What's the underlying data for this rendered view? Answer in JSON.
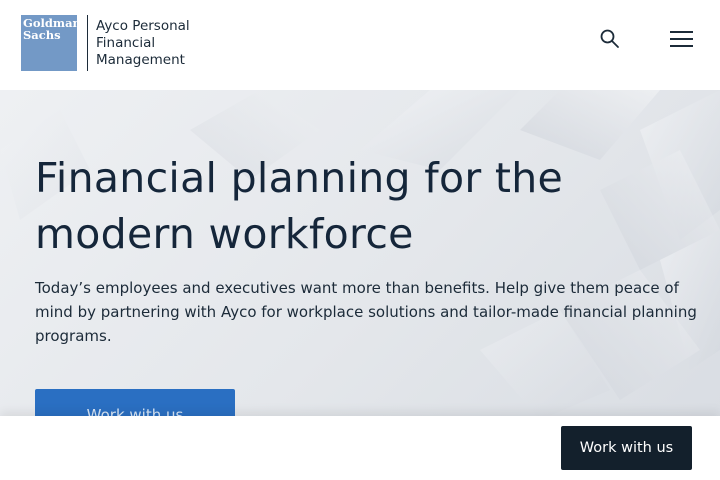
{
  "header": {
    "brand_logo": {
      "line1": "Goldman",
      "line2": "Sachs",
      "color": "#7399c6"
    },
    "product_name_lines": [
      "Ayco Personal",
      "Financial",
      "Management"
    ],
    "search_icon": "search-icon",
    "menu_icon": "hamburger-menu-icon"
  },
  "hero": {
    "title_lines": [
      "Financial planning for the",
      "modern workforce"
    ],
    "description_lines": [
      "Today’s employees and executives want more than benefits. Help give them peace of",
      "mind by partnering with Ayco for workplace solutions and tailor-made financial planning",
      "programs."
    ],
    "cta_label": "Work with us",
    "cta_color": "#2a6fc2"
  },
  "sticky_bar": {
    "cta_label": "Work with us",
    "cta_color": "#13202c"
  }
}
